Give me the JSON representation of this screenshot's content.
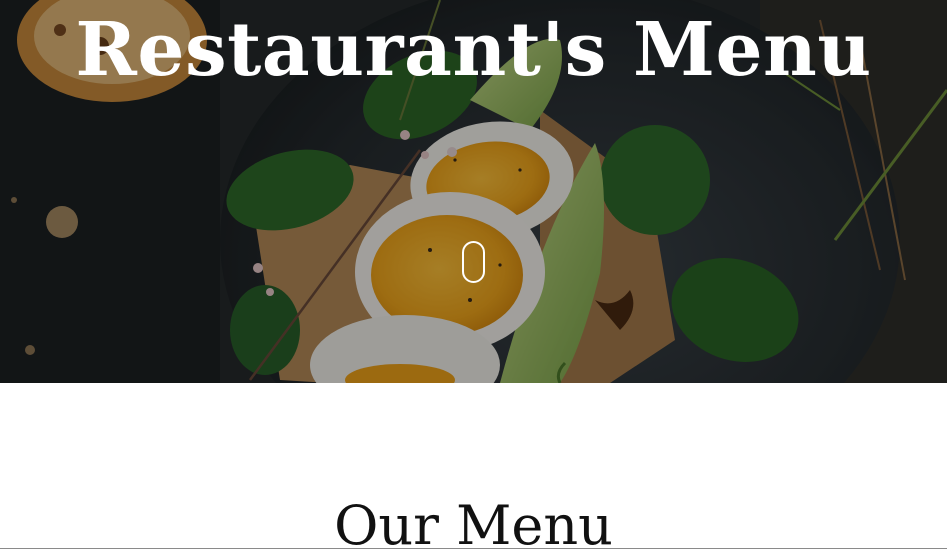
{
  "hero": {
    "title": "Restaurant's Menu",
    "background_image": "food-photo-eggs-avocado-toast-spinach",
    "scroll_icon": "mouse-scroll-icon"
  },
  "menu_section": {
    "title": "Our Menu"
  },
  "colors": {
    "hero_text": "#ffffff",
    "section_text": "#111111",
    "page_background": "#ffffff"
  }
}
